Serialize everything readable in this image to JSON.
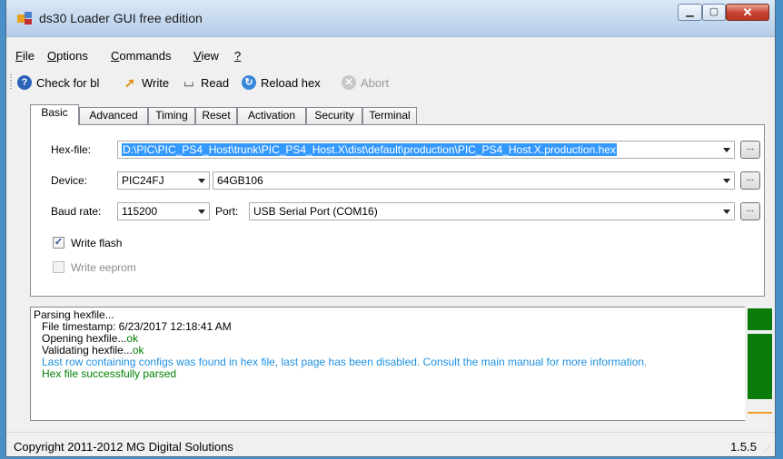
{
  "window": {
    "title": "ds30 Loader GUI free edition"
  },
  "menu": [
    {
      "label": "File",
      "key": "F",
      "rest": "ile"
    },
    {
      "label": "Options",
      "key": "O",
      "rest": "ptions"
    },
    {
      "label": "Commands",
      "key": "C",
      "rest": "ommands"
    },
    {
      "label": "View",
      "key": "V",
      "rest": "iew"
    },
    {
      "label": "?",
      "key": "?",
      "rest": ""
    }
  ],
  "toolbar": {
    "check": "Check for bl",
    "write": "Write",
    "read": "Read",
    "reload": "Reload hex",
    "abort": "Abort"
  },
  "tabs": [
    "Basic",
    "Advanced",
    "Timing",
    "Reset",
    "Activation",
    "Security",
    "Terminal"
  ],
  "basic": {
    "hexfile_label": "Hex-file:",
    "hexfile_value": "D:\\PIC\\PIC_PS4_Host\\trunk\\PIC_PS4_Host.X\\dist\\default\\production\\PIC_PS4_Host.X.production.hex",
    "device_label": "Device:",
    "device_family": "PIC24FJ",
    "device_model": "64GB106",
    "baud_label": "Baud rate:",
    "baud_value": "115200",
    "port_label": "Port:",
    "port_value": "USB Serial Port (COM16)",
    "browse": "...",
    "write_flash": "Write flash",
    "write_eeprom": "Write eeprom"
  },
  "log": [
    {
      "text": "Parsing hexfile...",
      "color": "#000000",
      "indent": 0
    },
    {
      "text": "File timestamp: 6/23/2017 12:18:41 AM",
      "color": "#000000",
      "indent": 1
    },
    {
      "text": "Opening hexfile...",
      "suffix": "ok",
      "color": "#000000",
      "indent": 1
    },
    {
      "text": "Validating hexfile...",
      "suffix": "ok",
      "color": "#000000",
      "indent": 1
    },
    {
      "text": "Last row containing configs was found in hex file, last page has been disabled. Consult the main manual for more information.",
      "color": "#1e90e0",
      "indent": 1
    },
    {
      "text": "Hex file successfully parsed",
      "color": "#008000",
      "indent": 1
    }
  ],
  "status": {
    "copyright": "Copyright 2011-2012 MG Digital Solutions",
    "version": "1.5.5"
  }
}
